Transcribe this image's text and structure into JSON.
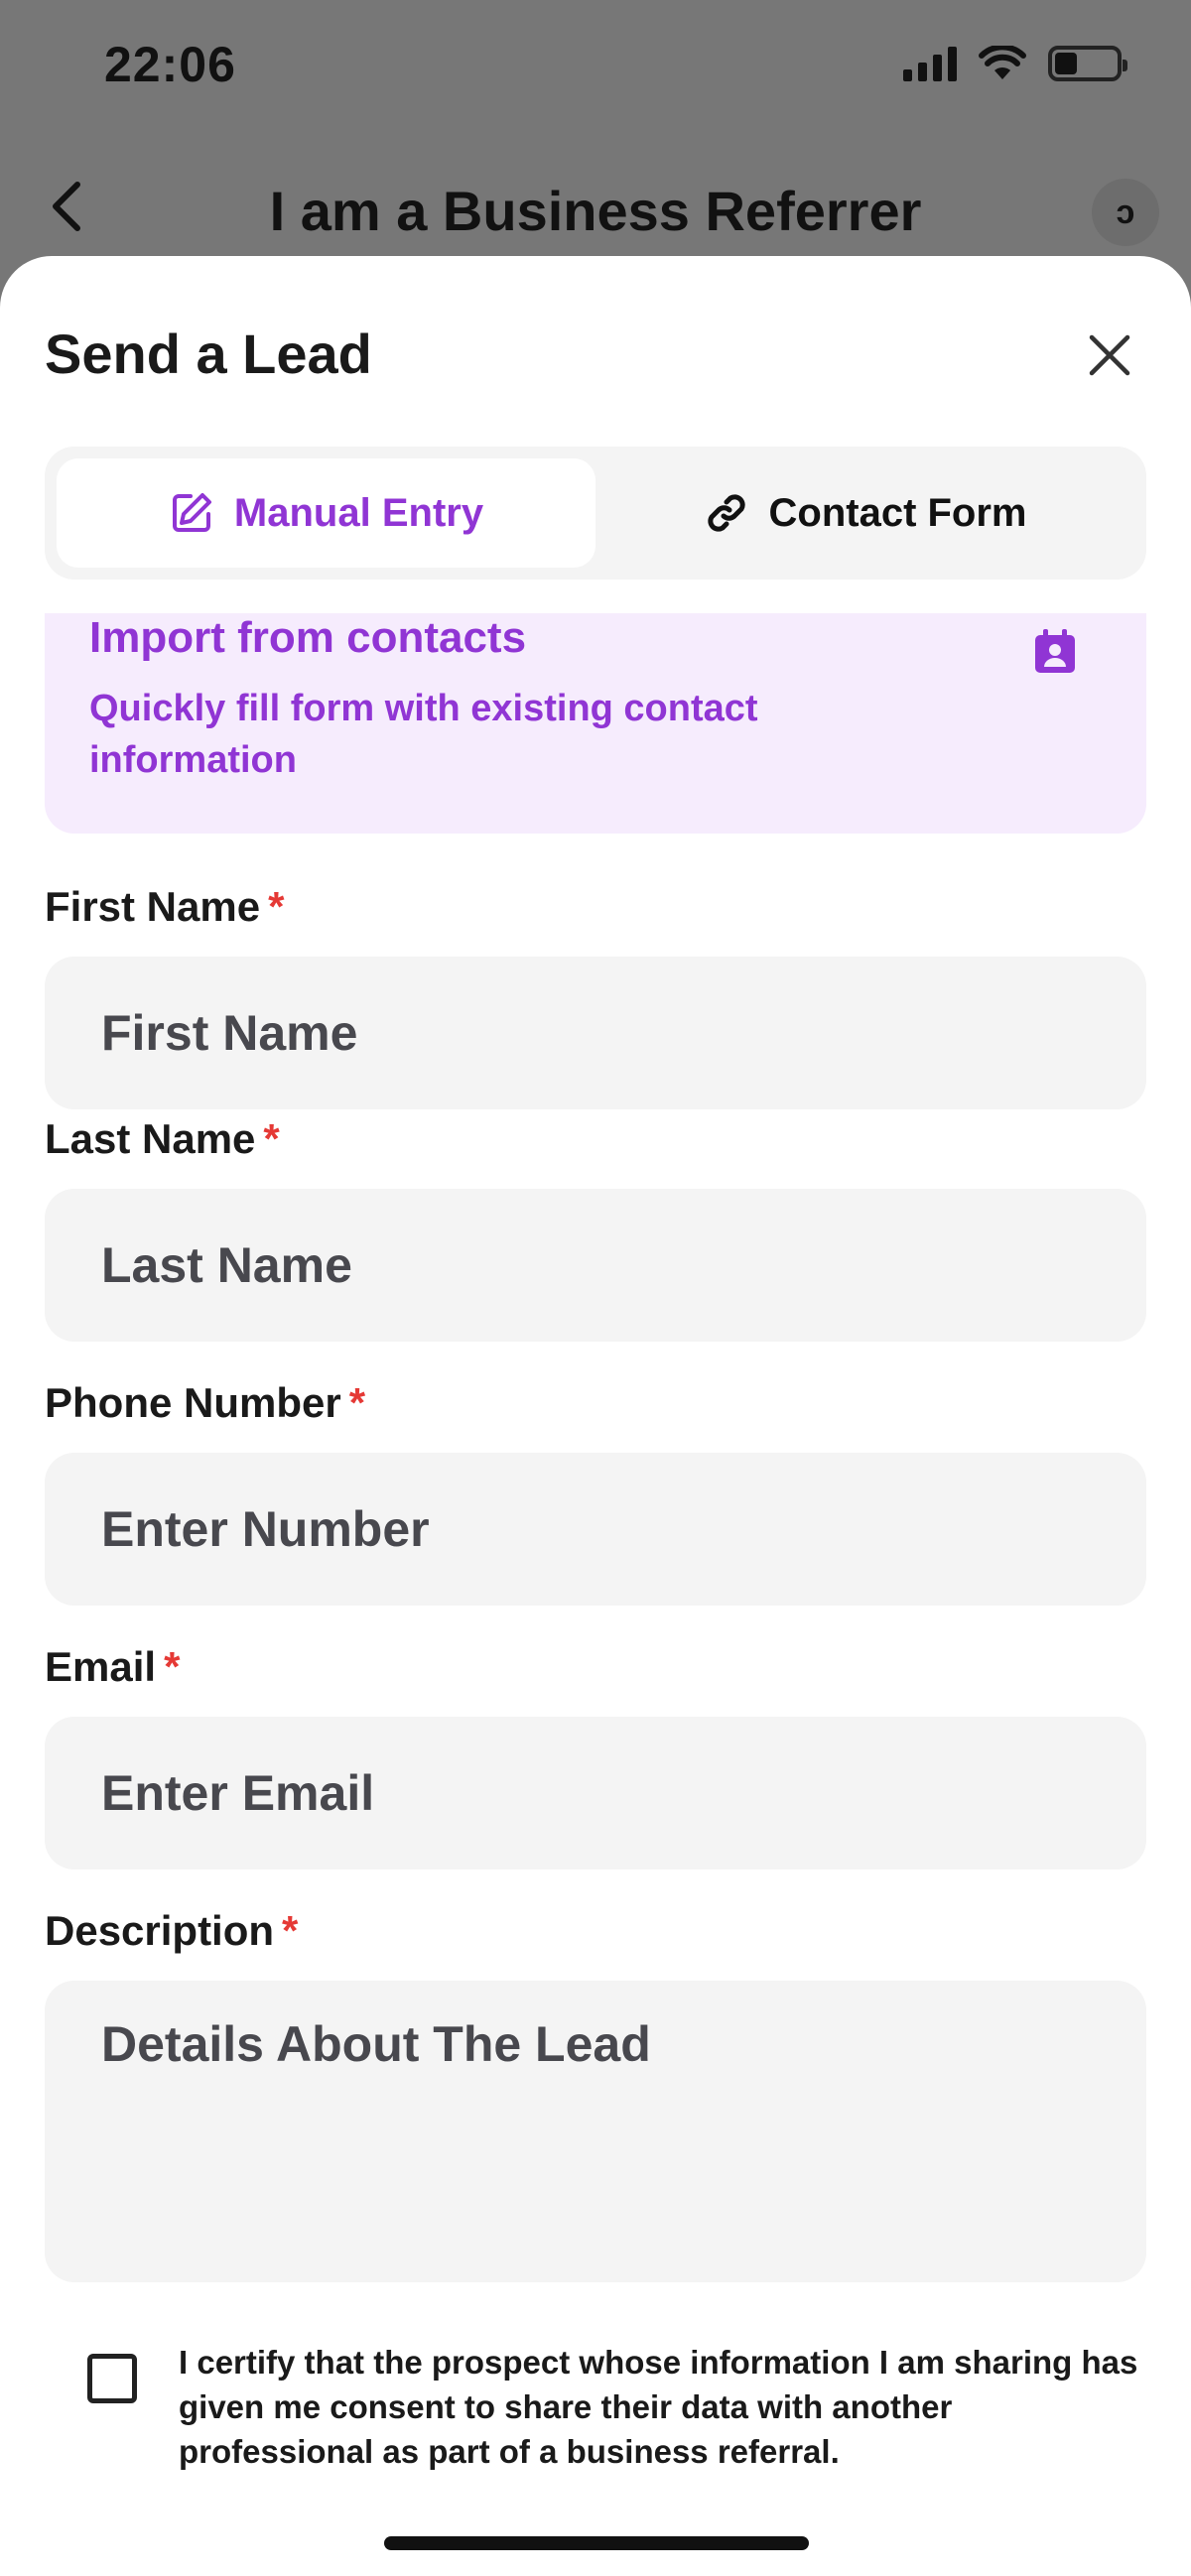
{
  "status_bar": {
    "time": "22:06"
  },
  "nav": {
    "title": "I am a Business Referrer",
    "right_badge": "ɔ"
  },
  "sheet": {
    "title": "Send a Lead"
  },
  "tabs": [
    {
      "label": "Manual Entry",
      "selected": true
    },
    {
      "label": "Contact Form",
      "selected": false
    }
  ],
  "import": {
    "title": "Import from contacts",
    "subtitle": "Quickly fill form with existing contact information"
  },
  "form": {
    "required_mark": "*",
    "first_name": {
      "label": "First Name",
      "placeholder": "First Name"
    },
    "last_name": {
      "label": "Last Name",
      "placeholder": "Last Name"
    },
    "phone": {
      "label": "Phone Number",
      "placeholder": "Enter Number"
    },
    "email": {
      "label": "Email",
      "placeholder": "Enter Email"
    },
    "description": {
      "label": "Description",
      "placeholder": "Details About The Lead"
    }
  },
  "consent": {
    "text": "I certify that the prospect whose information I am sharing has given me consent to share their data with another professional as part of a business referral.",
    "checked": false
  },
  "colors": {
    "accent": "#9035d4",
    "accent_bg": "#f6ecfd",
    "required": "#e53935",
    "field_bg": "#f4f4f4"
  }
}
